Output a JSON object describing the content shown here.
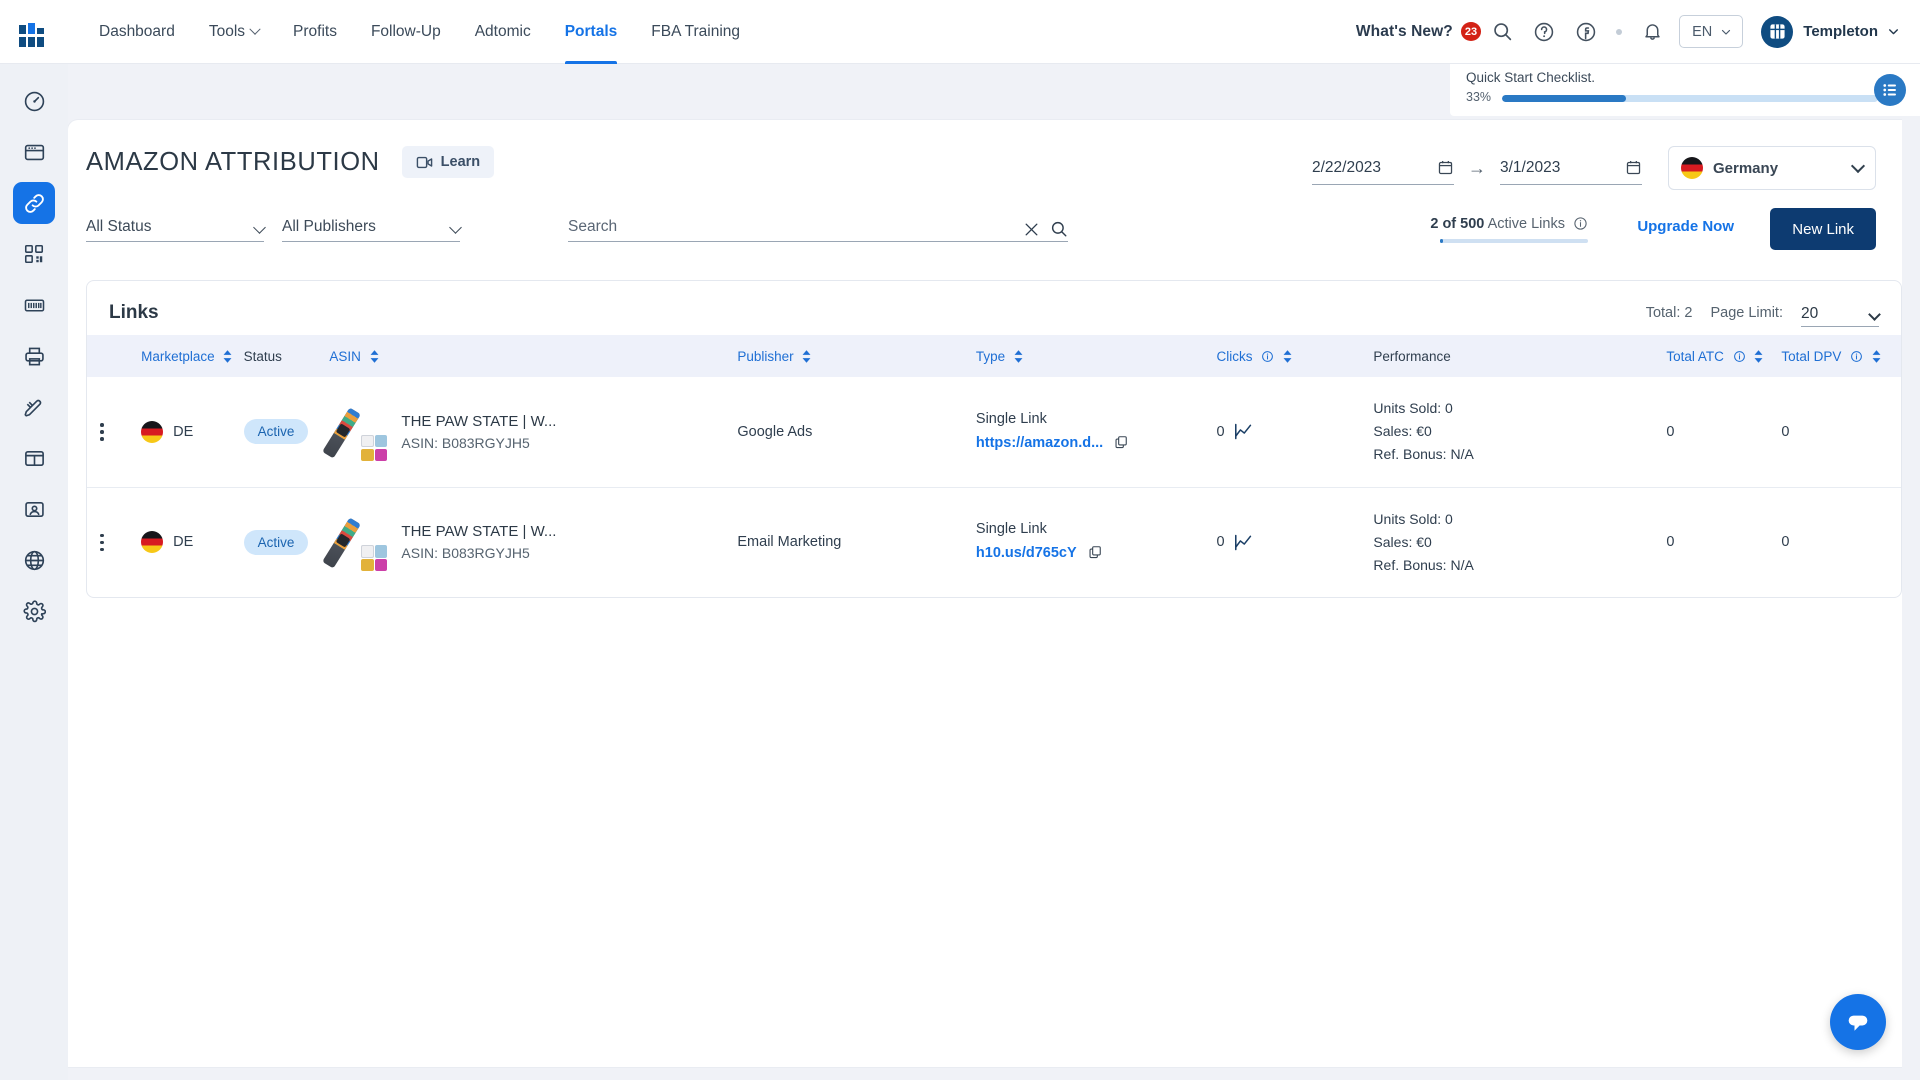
{
  "topnav": {
    "logo_name": "helium10-logo",
    "links": [
      {
        "label": "Dashboard",
        "active": false,
        "has_caret": false
      },
      {
        "label": "Tools",
        "active": false,
        "has_caret": true
      },
      {
        "label": "Profits",
        "active": false,
        "has_caret": false
      },
      {
        "label": "Follow-Up",
        "active": false,
        "has_caret": false
      },
      {
        "label": "Adtomic",
        "active": false,
        "has_caret": false
      },
      {
        "label": "Portals",
        "active": true,
        "has_caret": false
      },
      {
        "label": "FBA Training",
        "active": false,
        "has_caret": false
      }
    ],
    "whats_new_label": "What's New?",
    "whats_new_count": "23",
    "language": "EN",
    "user_name": "Templeton",
    "accent_blue": "#1573e6",
    "badge_red": "#d32216"
  },
  "quickstart": {
    "title": "Quick Start Checklist.",
    "percent_label": "33%",
    "percent_value": 33
  },
  "sidebar": {
    "items": [
      {
        "name": "dashboard-gauge",
        "label": "Dashboard",
        "active": false
      },
      {
        "name": "storefront",
        "label": "Storefront",
        "active": false
      },
      {
        "name": "link",
        "label": "Links",
        "active": true
      },
      {
        "name": "qr-code",
        "label": "QR Codes",
        "active": false
      },
      {
        "name": "barcode",
        "label": "Barcode",
        "active": false
      },
      {
        "name": "printer",
        "label": "Print",
        "active": false
      },
      {
        "name": "design-pen",
        "label": "Design",
        "active": false
      },
      {
        "name": "layout-columns",
        "label": "Layouts",
        "active": false
      },
      {
        "name": "id-card",
        "label": "Profile",
        "active": false
      },
      {
        "name": "globe",
        "label": "Domains",
        "active": false
      },
      {
        "name": "gear",
        "label": "Settings",
        "active": false
      }
    ]
  },
  "page": {
    "title": "AMAZON ATTRIBUTION",
    "learn_label": "Learn",
    "date_from": "2/22/2023",
    "date_to": "3/1/2023",
    "country": "Germany"
  },
  "filters": {
    "status_value": "All Status",
    "publisher_value": "All Publishers",
    "search_placeholder": "Search",
    "search_value": "",
    "active_links_prefix": "2 of 500",
    "active_links_suffix": "Active Links",
    "upgrade_label": "Upgrade Now",
    "new_link_label": "New Link"
  },
  "links_panel": {
    "title": "Links",
    "total_label": "Total: 2",
    "page_limit_label": "Page Limit:",
    "page_limit_value": "20",
    "columns": [
      {
        "label": "Marketplace",
        "sortable": true,
        "info": false,
        "link": true
      },
      {
        "label": "Status",
        "sortable": false,
        "info": false,
        "link": false
      },
      {
        "label": "ASIN",
        "sortable": true,
        "info": false,
        "link": true
      },
      {
        "label": "Publisher",
        "sortable": true,
        "info": false,
        "link": true
      },
      {
        "label": "Type",
        "sortable": true,
        "info": false,
        "link": true
      },
      {
        "label": "Clicks",
        "sortable": true,
        "info": true,
        "link": true
      },
      {
        "label": "Performance",
        "sortable": false,
        "info": false,
        "link": false
      },
      {
        "label": "Total ATC",
        "sortable": true,
        "info": true,
        "link": true
      },
      {
        "label": "Total DPV",
        "sortable": true,
        "info": true,
        "link": true
      }
    ],
    "rows": [
      {
        "marketplace": "DE",
        "status": "Active",
        "product_title": "THE PAW STATE | W...",
        "asin": "ASIN: B083RGYJH5",
        "publisher": "Google Ads",
        "type": "Single Link",
        "type_link": "https://amazon.d...",
        "clicks": "0",
        "units_sold": "Units Sold: 0",
        "sales": "Sales: €0",
        "ref_bonus": "Ref. Bonus: N/A",
        "total_atc": "0",
        "total_dpv": "0"
      },
      {
        "marketplace": "DE",
        "status": "Active",
        "product_title": "THE PAW STATE | W...",
        "asin": "ASIN: B083RGYJH5",
        "publisher": "Email Marketing",
        "type": "Single Link",
        "type_link": "h10.us/d765cY",
        "clicks": "0",
        "units_sold": "Units Sold: 0",
        "sales": "Sales: €0",
        "ref_bonus": "Ref. Bonus: N/A",
        "total_atc": "0",
        "total_dpv": "0"
      }
    ]
  },
  "chat": {
    "name": "chat-bubble-button"
  }
}
